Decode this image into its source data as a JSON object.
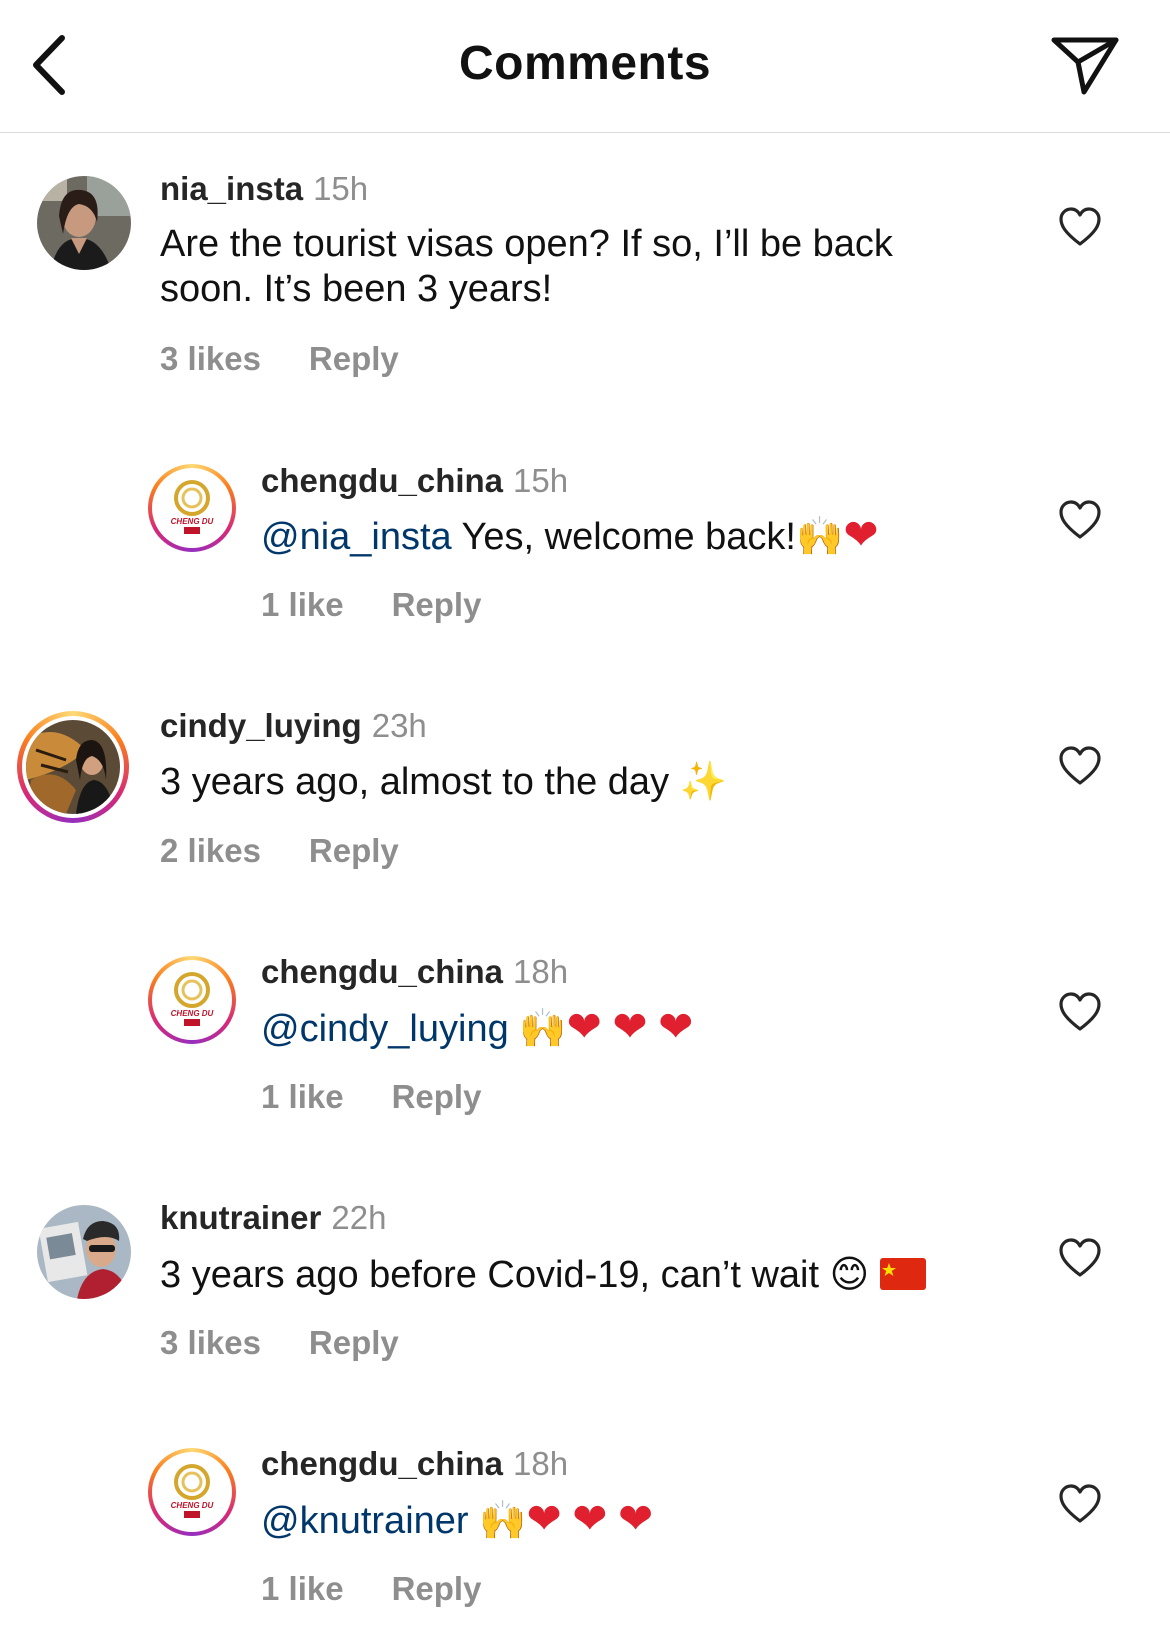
{
  "header": {
    "title": "Comments",
    "back_icon": "chevron-left-icon",
    "share_icon": "paper-plane-icon"
  },
  "comments": [
    {
      "username": "nia_insta",
      "time": "15h",
      "text": "Are the tourist visas open? If so, I’ll be back\nsoon. It’s been 3 years!",
      "likes": "3 likes",
      "reply": "Reply"
    },
    {
      "username": "chengdu_china",
      "time": "15h",
      "mention": "@nia_insta",
      "text": " Yes, welcome back!",
      "likes": "1 like",
      "reply": "Reply"
    },
    {
      "username": "cindy_luying",
      "time": "23h",
      "text": "3 years ago, almost to the day ",
      "likes": "2 likes",
      "reply": "Reply"
    },
    {
      "username": "chengdu_china",
      "time": "18h",
      "mention": "@cindy_luying",
      "likes": "1 like",
      "reply": "Reply"
    },
    {
      "username": "knutrainer",
      "time": "22h",
      "text": "3 years ago before Covid-19, can’t wait ",
      "likes": "3 likes",
      "reply": "Reply"
    },
    {
      "username": "chengdu_china",
      "time": "18h",
      "mention": "@knutrainer",
      "likes": "1 like",
      "reply": "Reply"
    }
  ],
  "avatar_logo_text": "CHENG DU",
  "colors": {
    "mention": "#00376b",
    "muted": "#8e8e8e",
    "heart": "#e0202f",
    "divider": "#dbdbdb"
  }
}
